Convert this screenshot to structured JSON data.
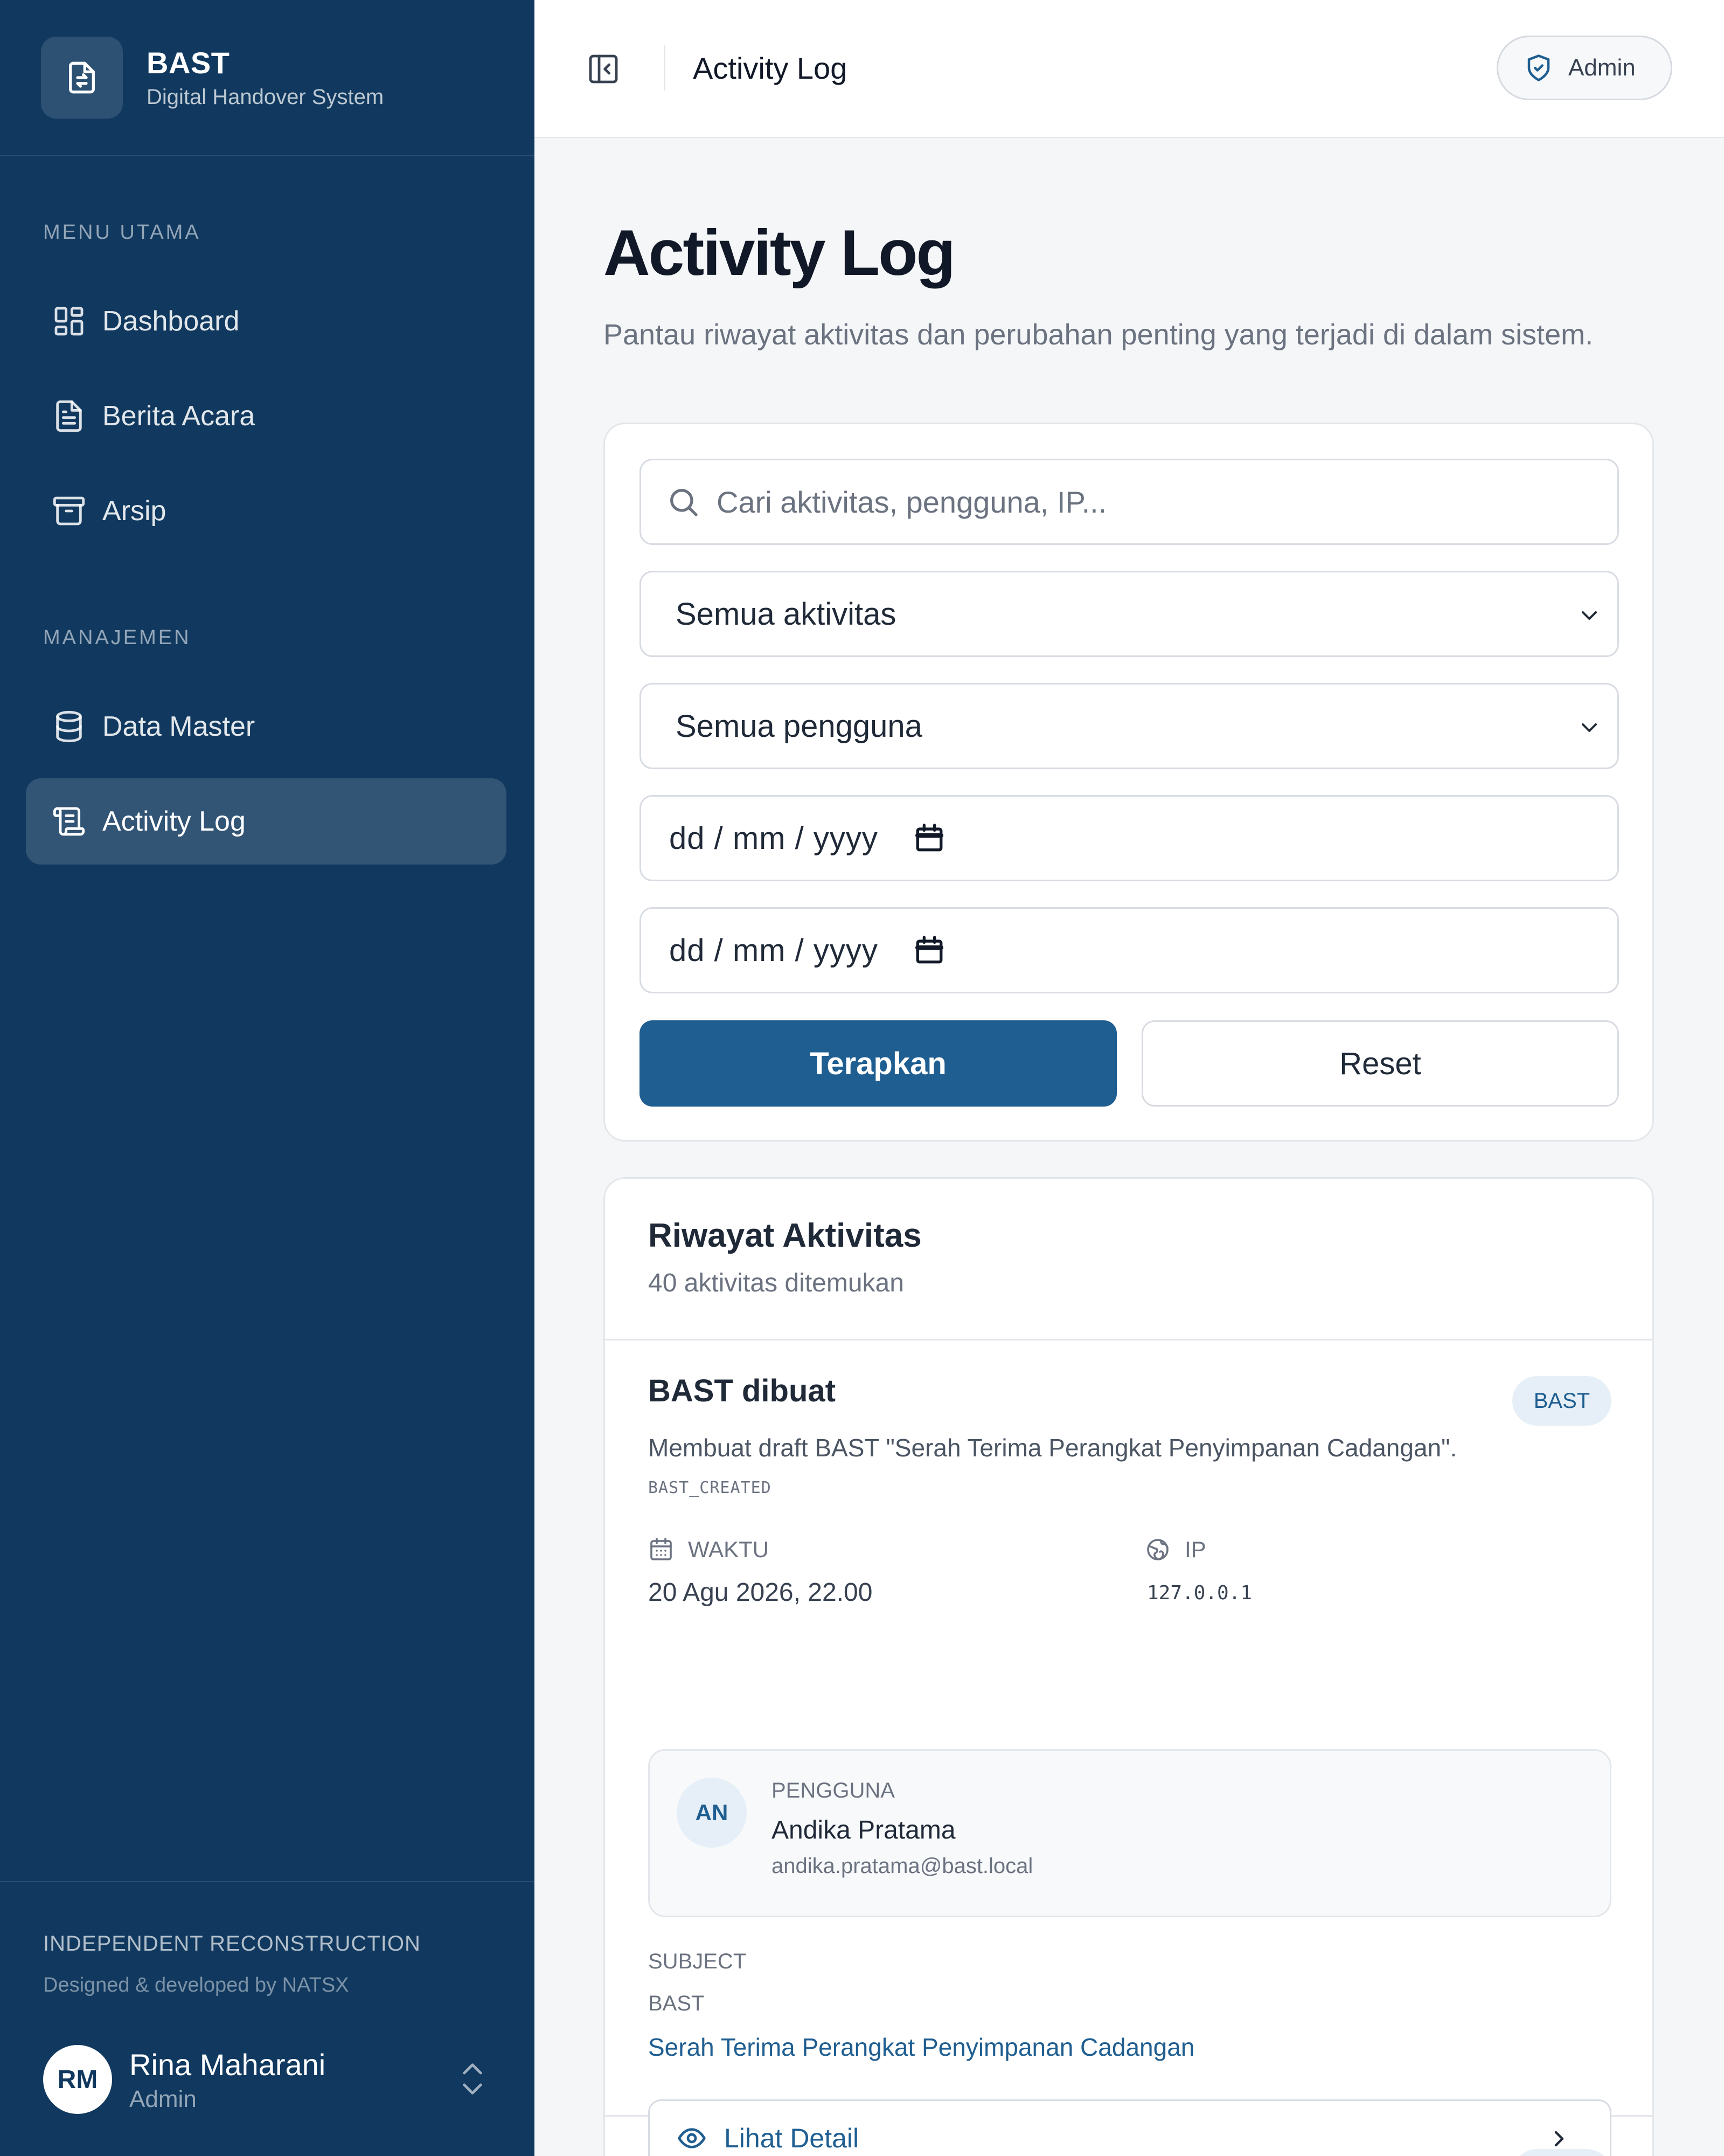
{
  "brand": {
    "name": "BAST",
    "subtitle": "Digital Handover System"
  },
  "sidebar": {
    "sections": [
      {
        "title": "MENU UTAMA"
      },
      {
        "title": "MANAJEMEN"
      }
    ],
    "items": [
      {
        "label": "Dashboard",
        "icon": "dashboard-icon",
        "active": false
      },
      {
        "label": "Berita Acara",
        "icon": "file-text-icon",
        "active": false
      },
      {
        "label": "Arsip",
        "icon": "archive-icon",
        "active": false
      },
      {
        "label": "Data Master",
        "icon": "database-icon",
        "active": false
      },
      {
        "label": "Activity Log",
        "icon": "scroll-icon",
        "active": true
      }
    ],
    "footer": {
      "credit_title": "INDEPENDENT RECONSTRUCTION",
      "credit_sub": "Designed & developed by NATSX",
      "user": {
        "initials": "RM",
        "name": "Rina Maharani",
        "role": "Admin"
      }
    }
  },
  "topbar": {
    "title": "Activity Log",
    "role_chip": "Admin"
  },
  "page": {
    "title": "Activity Log",
    "description": "Pantau riwayat aktivitas dan perubahan penting yang terjadi di dalam sistem."
  },
  "filters": {
    "search_placeholder": "Cari aktivitas, pengguna, IP...",
    "activity_select": "Semua aktivitas",
    "user_select": "Semua pengguna",
    "date_from": "dd / mm / yyyy",
    "date_to": "dd / mm / yyyy",
    "apply_label": "Terapkan",
    "reset_label": "Reset"
  },
  "log": {
    "title": "Riwayat Aktivitas",
    "count_text": "40 aktivitas ditemukan",
    "entries": [
      {
        "title": "BAST dibuat",
        "badge": "BAST",
        "description": "Membuat draft BAST \"Serah Terima Perangkat Penyimpanan Cadangan\".",
        "code": "BAST_CREATED",
        "time_label": "WAKTU",
        "time_value": "20 Agu 2026, 22.00",
        "ip_label": "IP",
        "ip_value": "127.0.0.1",
        "user_label": "PENGGUNA",
        "user_initials": "AN",
        "user_name": "Andika Pratama",
        "user_email": "andika.pratama@bast.local",
        "subject_label": "SUBJECT",
        "subject_type": "BAST",
        "subject_title": "Serah Terima Perangkat Penyimpanan Cadangan",
        "detail_label": "Lihat Detail"
      }
    ]
  },
  "colors": {
    "sidebar_bg": "#11395f",
    "primary": "#1f5e91",
    "page_bg": "#f5f6f8"
  }
}
